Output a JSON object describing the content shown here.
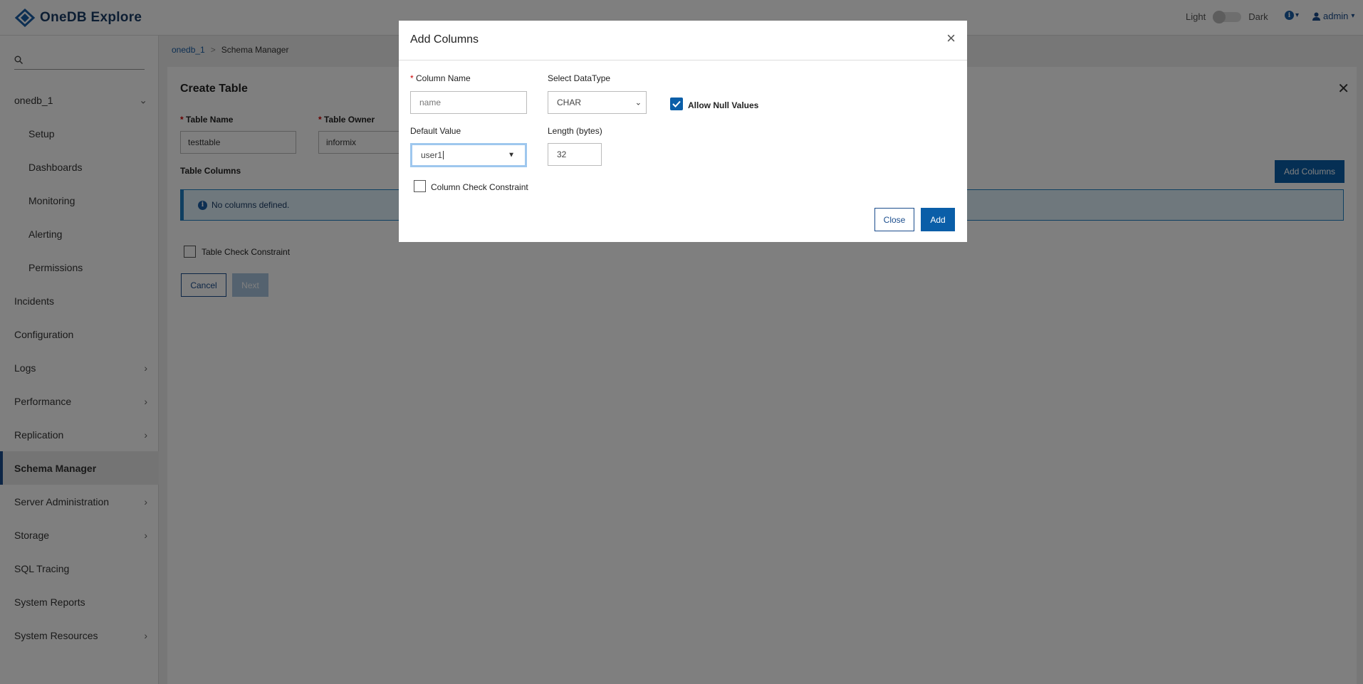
{
  "app": {
    "title": "OneDB Explore",
    "theme": {
      "light_label": "Light",
      "dark_label": "Dark"
    },
    "help_caret": "▾",
    "user": "admin"
  },
  "sidebar": {
    "search_placeholder": "",
    "items": [
      {
        "label": "onedb_1",
        "chevron": "down"
      },
      {
        "label": "Setup"
      },
      {
        "label": "Dashboards"
      },
      {
        "label": "Monitoring"
      },
      {
        "label": "Alerting"
      },
      {
        "label": "Permissions"
      },
      {
        "label": "Incidents"
      },
      {
        "label": "Configuration"
      },
      {
        "label": "Logs",
        "chevron": "right"
      },
      {
        "label": "Performance",
        "chevron": "right"
      },
      {
        "label": "Replication",
        "chevron": "right"
      },
      {
        "label": "Schema Manager",
        "active": true
      },
      {
        "label": "Server Administration",
        "chevron": "right"
      },
      {
        "label": "Storage",
        "chevron": "right"
      },
      {
        "label": "SQL Tracing"
      },
      {
        "label": "System Reports"
      },
      {
        "label": "System Resources",
        "chevron": "right"
      }
    ]
  },
  "breadcrumb": {
    "root": "onedb_1",
    "separator": ">",
    "current": "Schema Manager"
  },
  "create_table": {
    "title": "Create Table",
    "table_name_label": "Table Name",
    "table_name_value": "testtable",
    "table_owner_label": "Table Owner",
    "table_owner_value": "informix",
    "columns_label": "Table Columns",
    "add_columns_button": "Add Columns",
    "no_columns_message": "No columns defined.",
    "check_constraint_label": "Table Check Constraint",
    "cancel_button": "Cancel",
    "next_button": "Next",
    "required_mark": "*"
  },
  "modal": {
    "title": "Add Columns",
    "close_x": "×",
    "column_name_label": "Column Name",
    "column_name_placeholder": "name",
    "datatype_label": "Select DataType",
    "datatype_value": "CHAR",
    "allow_null_label": "Allow Null Values",
    "allow_null_checked": true,
    "default_value_label": "Default Value",
    "default_value": "user1",
    "length_label": "Length (bytes)",
    "length_value": "32",
    "column_check_label": "Column Check Constraint",
    "close_button": "Close",
    "add_button": "Add"
  },
  "colors": {
    "primary": "#0a5ea8",
    "brand": "#1a3d66",
    "info_bg": "#dff0fa",
    "required": "#cc0000"
  }
}
